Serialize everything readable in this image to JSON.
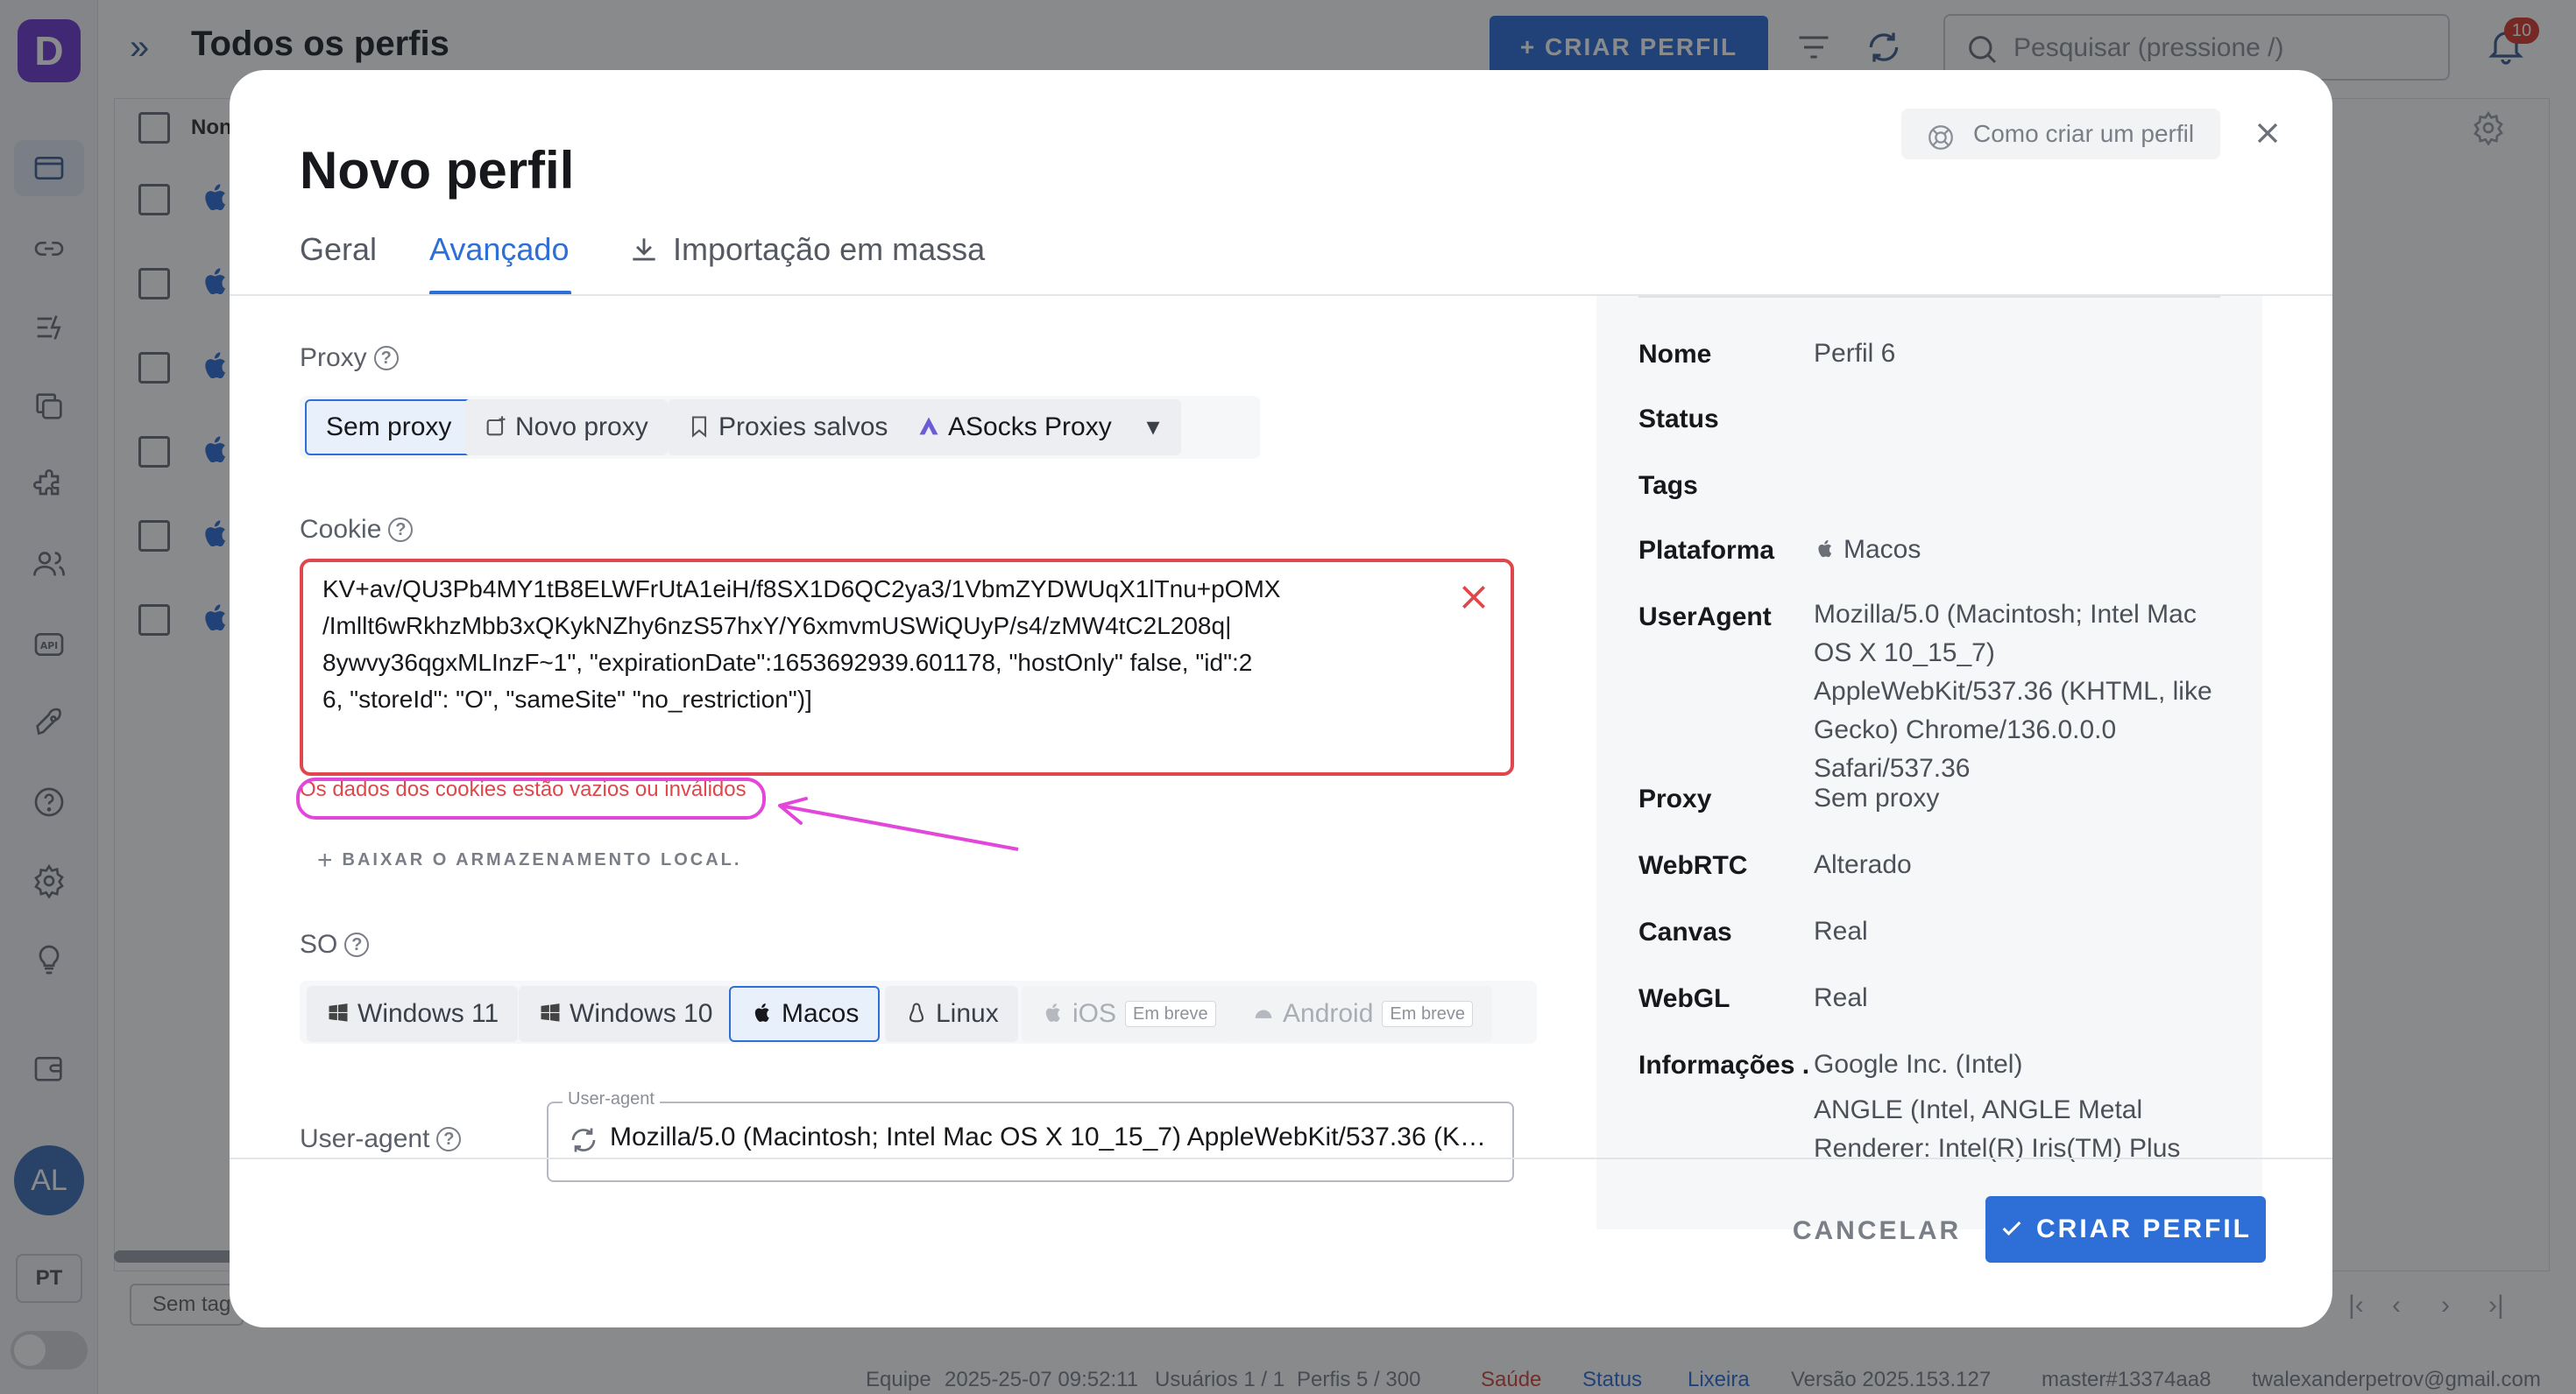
{
  "app": {
    "logo_letter": "D",
    "page_title": "Todos os perfis",
    "create_button": "+ CRIAR PERFIL",
    "search_placeholder": "Pesquisar (pressione /)",
    "notification_count": "10",
    "column_name": "Non",
    "avatar_initials": "AL",
    "language": "PT",
    "tag_filter": "Sem tag",
    "accent_color": "#2e6fd7",
    "status": {
      "team": "Equipe",
      "date": "2025-25-07 09:52:11",
      "users": "Usuários 1 / 1",
      "profiles": "Perfis 5 / 300",
      "health": "Saúde",
      "status": "Status",
      "trash": "Lixeira",
      "version": "Versão 2025.153.127",
      "branch": "master#13374aa8",
      "email": "twalexanderpetrov@gmail.com"
    }
  },
  "modal": {
    "title": "Novo perfil",
    "how_to": "Como criar um perfil",
    "tabs": {
      "general": "Geral",
      "advanced": "Avançado",
      "bulk_import": "Importação em massa"
    },
    "proxy": {
      "label": "Proxy",
      "options": {
        "none": "Sem proxy",
        "new": "Novo proxy",
        "saved": "Proxies salvos",
        "asocks": "ASocks Proxy"
      },
      "selected": "Sem proxy"
    },
    "cookie": {
      "label": "Cookie",
      "value": "KV+av/QU3Pb4MY1tB8ELWFrUtA1eiH/f8SX1D6QC2ya3/1VbmZYDWUqX1lTnu+pOMX\n/Imllt6wRkhzMbb3xQKykNZhy6nzS57hxY/Y6xmvmUSWiQUyP/s4/zMW4tC2L208q|\n8ywvy36qgxMLInzF~1\", \"expirationDate\":1653692939.601178, \"hostOnly\" false, \"id\":2\n6, \"storeId\": \"O\", \"sameSite\" \"no_restriction\")]",
      "error": "Os dados dos cookies estão vazios ou inválidos",
      "download_link": "BAIXAR O ARMAZENAMENTO LOCAL."
    },
    "os": {
      "label": "SO",
      "options": {
        "win11": "Windows 11",
        "win10": "Windows 10",
        "macos": "Macos",
        "linux": "Linux",
        "ios": "iOS",
        "android": "Android"
      },
      "soon_badge": "Em breve",
      "selected": "Macos"
    },
    "user_agent": {
      "label": "User-agent",
      "legend": "User-agent",
      "value": "Mozilla/5.0 (Macintosh; Intel Mac OS X 10_15_7) AppleWebKit/537.36 (KHTML,..."
    },
    "summary": {
      "name_key": "Nome",
      "name_val": "Perfil 6",
      "status_key": "Status",
      "tags_key": "Tags",
      "platform_key": "Plataforma",
      "platform_val": "Macos",
      "ua_key": "UserAgent",
      "ua_val": "Mozilla/5.0 (Macintosh; Intel Mac OS X 10_15_7) AppleWebKit/537.36 (KHTML, like Gecko) Chrome/136.0.0.0 Safari/537.36",
      "proxy_key": "Proxy",
      "proxy_val": "Sem proxy",
      "webrtc_key": "WebRTC",
      "webrtc_val": "Alterado",
      "canvas_key": "Canvas",
      "canvas_val": "Real",
      "webgl_key": "WebGL",
      "webgl_val": "Real",
      "info_key": "Informações ...",
      "info_val": "Google Inc. (Intel)",
      "info_val2": "ANGLE (Intel, ANGLE Metal Renderer: Intel(R) Iris(TM) Plus"
    },
    "footer": {
      "cancel": "CANCELAR",
      "create": "CRIAR PERFIL"
    }
  }
}
